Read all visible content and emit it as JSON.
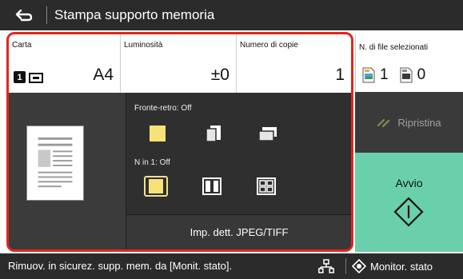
{
  "header": {
    "title": "Stampa supporto memoria",
    "back_icon": "back-arrow-icon"
  },
  "settings": {
    "paper": {
      "label": "Carta",
      "tray_number": "1",
      "value": "A4"
    },
    "brightness": {
      "label": "Luminosità",
      "value": "±0"
    },
    "copies": {
      "label": "Numero di copie",
      "value": "1"
    }
  },
  "selected_files": {
    "label": "N. di file selezionati",
    "jpeg_count": "1",
    "tiff_count": "0"
  },
  "options": {
    "duplex_label": "Fronte-retro: Off",
    "nin1_label": "N in 1: Off",
    "jpeg_tiff_button": "Imp. dett. JPEG/TIFF"
  },
  "actions": {
    "reset_label": "Ripristina",
    "start_label": "Avvio"
  },
  "status_bar": {
    "message": "Rimuov. in sicurez. supp. mem. da [Monit. stato].",
    "monitor_label": "Monitor. stato"
  },
  "colors": {
    "accent_frame": "#e1261c",
    "start_button": "#6ad0ab",
    "selected_option": "#f7e27a",
    "dark_bg": "#2b2b2b"
  }
}
